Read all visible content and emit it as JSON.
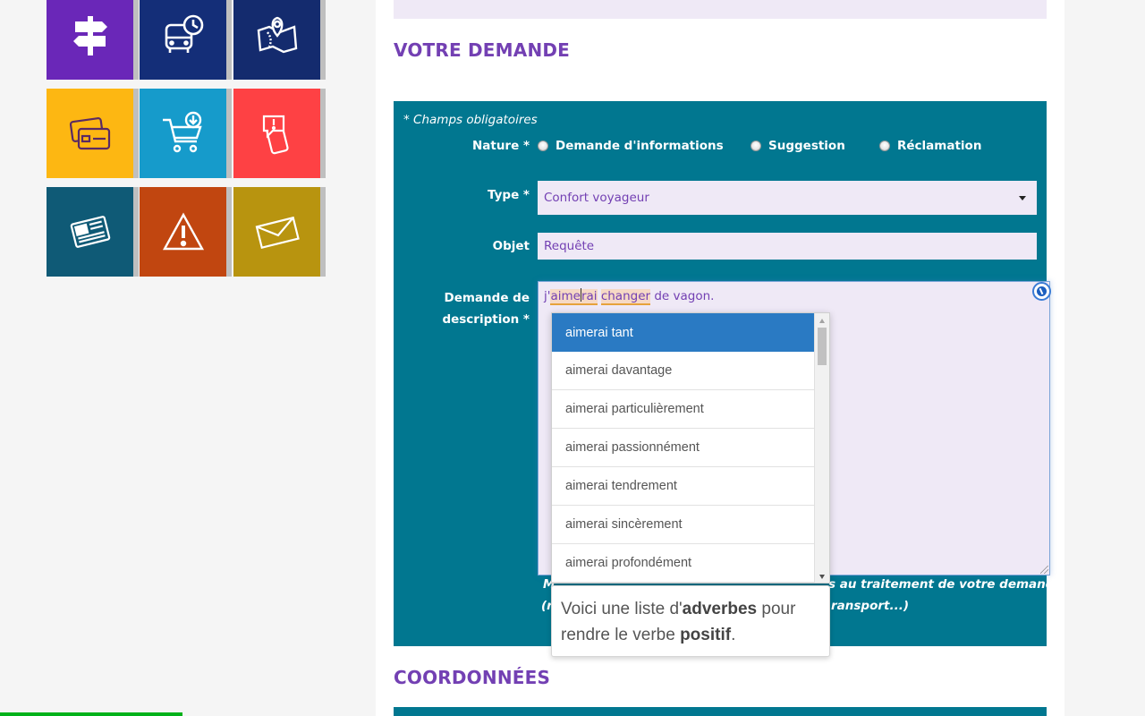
{
  "tiles": [
    {
      "name": "signpost",
      "color": "#6a27b8",
      "icon": "signpost-icon"
    },
    {
      "name": "bus-schedule",
      "color": "#142e78",
      "icon": "bus-clock-icon"
    },
    {
      "name": "map",
      "color": "#142b6e",
      "icon": "map-pin-icon"
    },
    {
      "name": "cards",
      "color": "#fdb712",
      "icon": "card-icon"
    },
    {
      "name": "cart",
      "color": "#169bcb",
      "icon": "cart-icon"
    },
    {
      "name": "phone-alert",
      "color": "#fe4144",
      "icon": "phone-alert-icon"
    },
    {
      "name": "news",
      "color": "#0f5a76",
      "icon": "newspaper-icon"
    },
    {
      "name": "warning",
      "color": "#c14610",
      "icon": "warning-icon"
    },
    {
      "name": "mail",
      "color": "#b8940f",
      "icon": "mail-icon"
    }
  ],
  "sections": {
    "request_title": "VOTRE DEMANDE",
    "contact_title": "COORDONNÉES"
  },
  "form": {
    "required_note": "* Champs obligatoires",
    "nature_label": "Nature *",
    "nature_options": [
      "Demande d'informations",
      "Suggestion",
      "Réclamation"
    ],
    "type_label": "Type *",
    "type_value": "Confort voyageur",
    "object_label": "Objet",
    "object_value": "Requête",
    "description_label_line1": "Demande de",
    "description_label_line2": "description *",
    "description_text": {
      "prefix": "j'",
      "word1_a": "aime",
      "word1_b": "rai",
      "space": " ",
      "word2": "changer",
      "suffix": " de vagon."
    },
    "hint_line1_start": "M",
    "hint_line1_end": "s au traitement de votre demande",
    "hint_line2_start": "(r",
    "hint_line2_end": "ransport...)"
  },
  "suggestions": [
    "aimerai tant",
    "aimerai davantage",
    "aimerai particulièrement",
    "aimerai passionnément",
    "aimerai tendrement",
    "aimerai sincèrement",
    "aimerai profondément"
  ],
  "tip": {
    "part1": "Voici une liste d'",
    "bold1": "adverbes",
    "part2": " pour rendre le verbe ",
    "bold2": "positif",
    "part3": "."
  },
  "colors": {
    "accent_purple": "#7340b3",
    "panel_teal": "#017790",
    "field_bg": "#efe9f6",
    "suggest_active": "#2a7ac3",
    "progress_green": "#00b119"
  }
}
